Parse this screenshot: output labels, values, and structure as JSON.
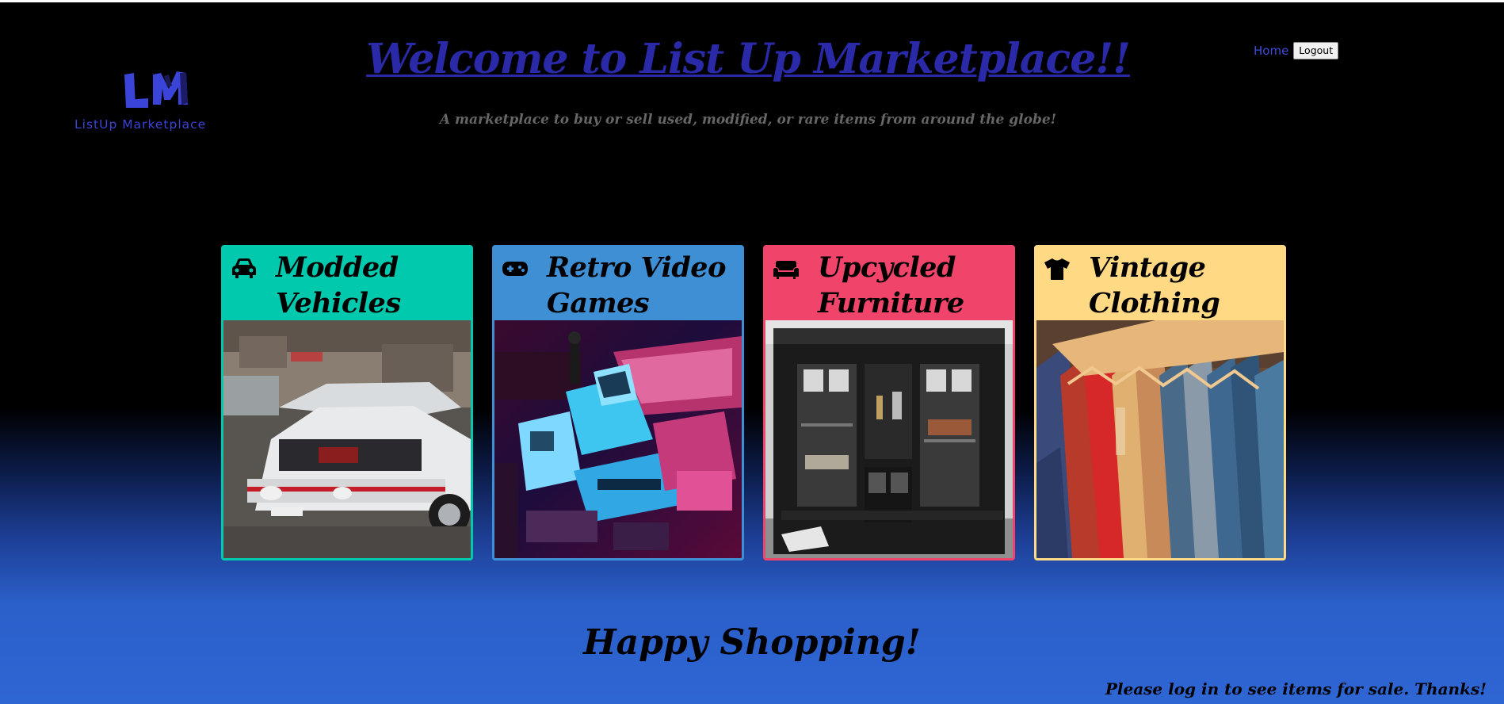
{
  "logo": {
    "text": "ListUp Marketplace",
    "color": "#3a44d8"
  },
  "header": {
    "title": "Welcome to List Up Marketplace!!",
    "subtitle": "A marketplace to buy or sell used, modified, or rare items from around the globe!"
  },
  "nav": {
    "home": "Home",
    "logout": "Logout"
  },
  "categories": [
    {
      "title": "Modded Vehicles",
      "icon": "car-icon",
      "color": "#00c9ad",
      "image": "modified car with open hood"
    },
    {
      "title": "Retro Video Games",
      "icon": "gamepad-icon",
      "color": "#3f8fd4",
      "image": "retro consoles under neon light"
    },
    {
      "title": "Upcycled Furniture",
      "icon": "couch-icon",
      "color": "#f0446a",
      "image": "rustic glass cabinet"
    },
    {
      "title": "Vintage Clothing",
      "icon": "tshirt-icon",
      "color": "#ffd983",
      "image": "rack of colorful shirts"
    }
  ],
  "footer": {
    "greeting": "Happy Shopping!",
    "login_note": "Please log in to see items for sale. Thanks!"
  },
  "colors": {
    "link": "#3c4cd6",
    "title": "#2a2aa8",
    "background_bottom": "#2e66d4"
  }
}
